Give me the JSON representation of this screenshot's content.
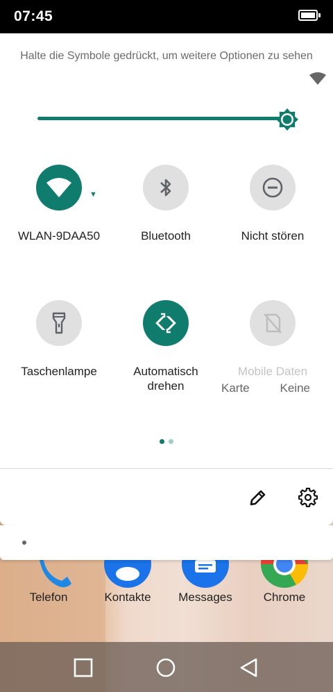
{
  "status_bar": {
    "time": "07:45"
  },
  "quick_settings": {
    "hint": "Halte die Symbole gedrückt, um weitere Optionen zu sehen",
    "brightness": {
      "level": 1.0
    },
    "tiles": [
      {
        "label": "WLAN-9DAA50",
        "icon": "wifi-icon",
        "active": true
      },
      {
        "label": "Bluetooth",
        "icon": "bluetooth-icon",
        "active": false
      },
      {
        "label": "Nicht stören",
        "icon": "do-not-disturb-icon",
        "active": false
      },
      {
        "label": "Taschenlampe",
        "icon": "flashlight-icon",
        "active": false
      },
      {
        "label_line1": "Automatisch",
        "label_line2": "drehen",
        "icon": "auto-rotate-icon",
        "active": true
      },
      {
        "label": "Mobile Daten",
        "sub_left": "Karte",
        "sub_right": "Keine",
        "icon": "mobile-data-off-icon",
        "active": false,
        "disabled": true
      }
    ],
    "page_indicator": {
      "pages": 2,
      "current": 1
    }
  },
  "dock": [
    {
      "label": "Telefon",
      "icon": "phone-icon"
    },
    {
      "label": "Kontakte",
      "icon": "contacts-icon"
    },
    {
      "label": "Messages",
      "icon": "messages-icon"
    },
    {
      "label": "Chrome",
      "icon": "chrome-icon"
    }
  ],
  "colors": {
    "accent": "#0f7c6e",
    "tile_off": "#e0e0e0"
  }
}
